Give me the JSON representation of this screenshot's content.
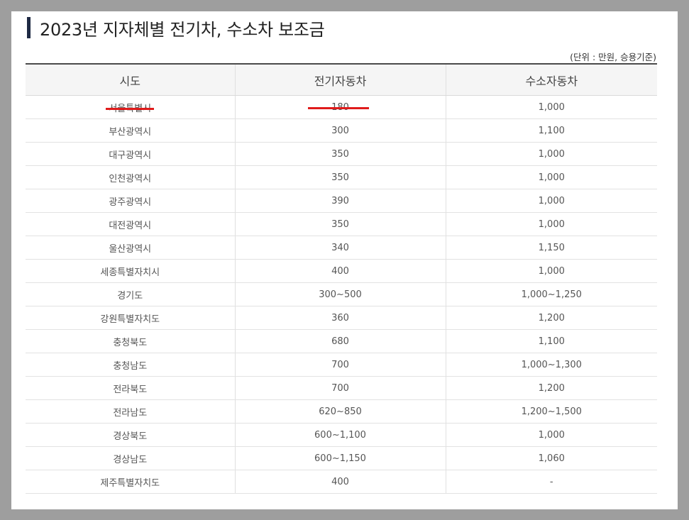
{
  "title": "2023년 지자체별 전기차, 수소차 보조금",
  "unit_note": "(단위 : 만원, 승용기준)",
  "table": {
    "headers": [
      "시도",
      "전기자동차",
      "수소자동차"
    ],
    "rows": [
      {
        "region": "서울특별시",
        "ev": "180",
        "hydrogen": "1,000"
      },
      {
        "region": "부산광역시",
        "ev": "300",
        "hydrogen": "1,100"
      },
      {
        "region": "대구광역시",
        "ev": "350",
        "hydrogen": "1,000"
      },
      {
        "region": "인천광역시",
        "ev": "350",
        "hydrogen": "1,000"
      },
      {
        "region": "광주광역시",
        "ev": "390",
        "hydrogen": "1,000"
      },
      {
        "region": "대전광역시",
        "ev": "350",
        "hydrogen": "1,000"
      },
      {
        "region": "울산광역시",
        "ev": "340",
        "hydrogen": "1,150"
      },
      {
        "region": "세종특별자치시",
        "ev": "400",
        "hydrogen": "1,000"
      },
      {
        "region": "경기도",
        "ev": "300~500",
        "hydrogen": "1,000~1,250"
      },
      {
        "region": "강원특별자치도",
        "ev": "360",
        "hydrogen": "1,200"
      },
      {
        "region": "충청북도",
        "ev": "680",
        "hydrogen": "1,100"
      },
      {
        "region": "충청남도",
        "ev": "700",
        "hydrogen": "1,000~1,300"
      },
      {
        "region": "전라북도",
        "ev": "700",
        "hydrogen": "1,200"
      },
      {
        "region": "전라남도",
        "ev": "620~850",
        "hydrogen": "1,200~1,500"
      },
      {
        "region": "경상북도",
        "ev": "600~1,100",
        "hydrogen": "1,000"
      },
      {
        "region": "경상남도",
        "ev": "600~1,150",
        "hydrogen": "1,060"
      },
      {
        "region": "제주특별자치도",
        "ev": "400",
        "hydrogen": "-"
      }
    ]
  },
  "colors": {
    "title_mark": "#1f2a44",
    "highlight_underline": "#e01b1b",
    "header_bg": "#f5f5f5",
    "background": "#9e9e9e"
  }
}
